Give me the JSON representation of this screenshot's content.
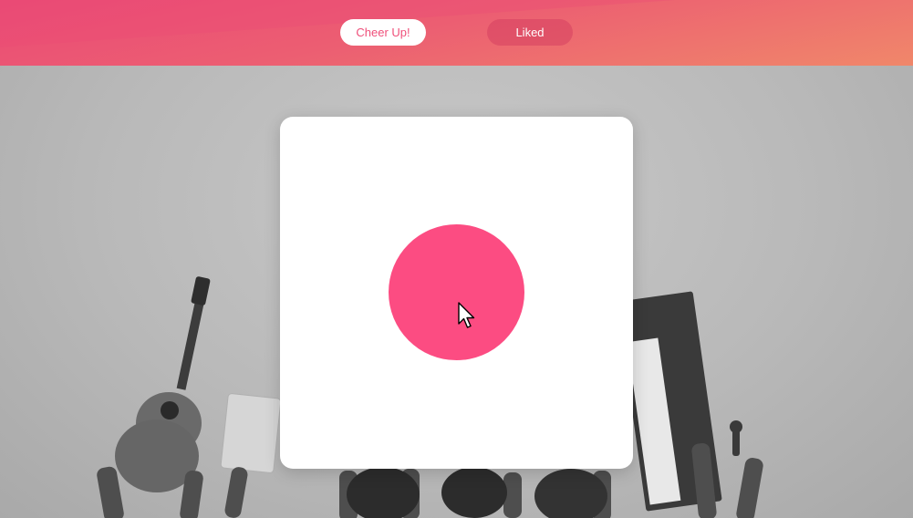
{
  "nav": {
    "tabs": [
      {
        "label": "Cheer Up!",
        "active": true
      },
      {
        "label": "Liked",
        "active": false
      }
    ]
  },
  "colors": {
    "header_gradient_start": "#ea4a76",
    "header_gradient_end": "#f0876a",
    "accent": "#fc4c82",
    "card_background": "#ffffff"
  },
  "icons": {
    "cursor": "pointer-cursor-icon"
  }
}
